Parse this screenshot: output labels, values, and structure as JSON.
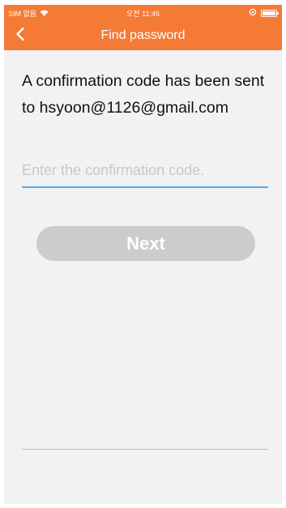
{
  "status_bar": {
    "carrier": "SIM 없음",
    "time": "오전 11:46"
  },
  "nav": {
    "title": "Find password"
  },
  "content": {
    "message": "A confirmation code has been sent to hsyoon@1126@gmail.com",
    "code_input": {
      "value": "",
      "placeholder": "Enter the confirmation code."
    },
    "next_label": "Next"
  },
  "colors": {
    "accent": "#f47a35",
    "input_underline": "#5aa8e8",
    "button_disabled": "#cccccc",
    "background": "#f2f2f2"
  },
  "icons": {
    "back": "chevron-left-icon",
    "wifi": "wifi-icon",
    "lock": "rotation-lock-icon",
    "battery": "battery-icon"
  }
}
